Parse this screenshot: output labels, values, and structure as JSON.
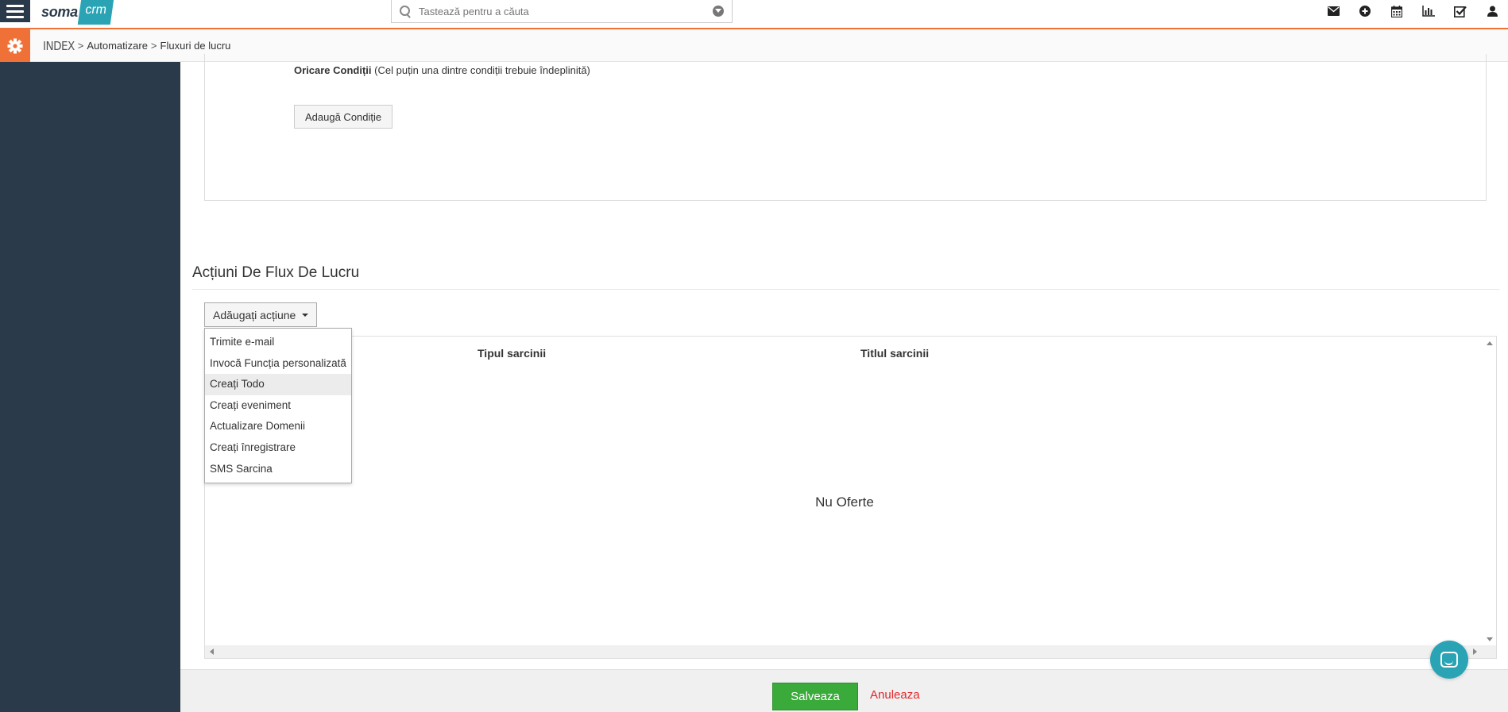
{
  "header": {
    "logo_soma": "soma",
    "logo_crm": "crm",
    "search_placeholder": "Tastează pentru a căuta",
    "icons": [
      "envelope-icon",
      "plus-circle-icon",
      "calendar-icon",
      "bar-chart-icon",
      "check-square-icon",
      "user-icon"
    ]
  },
  "breadcrumb": {
    "index": "INDEX",
    "items": [
      "Automatizare",
      "Fluxuri de lucru"
    ],
    "separator": ">"
  },
  "conditions": {
    "label_bold": "Oricare Condiții",
    "label_note": "(Cel puțin una dintre condiții trebuie îndeplinită)",
    "add_button": "Adaugă Condiție"
  },
  "actions": {
    "section_title": "Acțiuni De Flux De Lucru",
    "add_button": "Adăugați acțiune",
    "menu": [
      "Trimite e-mail",
      "Invocă Funcția personalizată",
      "Creați Todo",
      "Creați eveniment",
      "Actualizare Domenii",
      "Creați înregistrare",
      "SMS Sarcina"
    ],
    "hovered_index": 2,
    "table": {
      "columns": [
        "Tipul sarcinii",
        "Titlul sarcinii"
      ],
      "empty_text": "Nu Oferte"
    }
  },
  "footer": {
    "save": "Salveaza",
    "cancel": "Anuleaza"
  },
  "colors": {
    "accent": "#f07138",
    "sidebar": "#2b3a4a",
    "save": "#3aaa3a",
    "cancel": "#e3262b",
    "chat": "#2aa4b5"
  }
}
